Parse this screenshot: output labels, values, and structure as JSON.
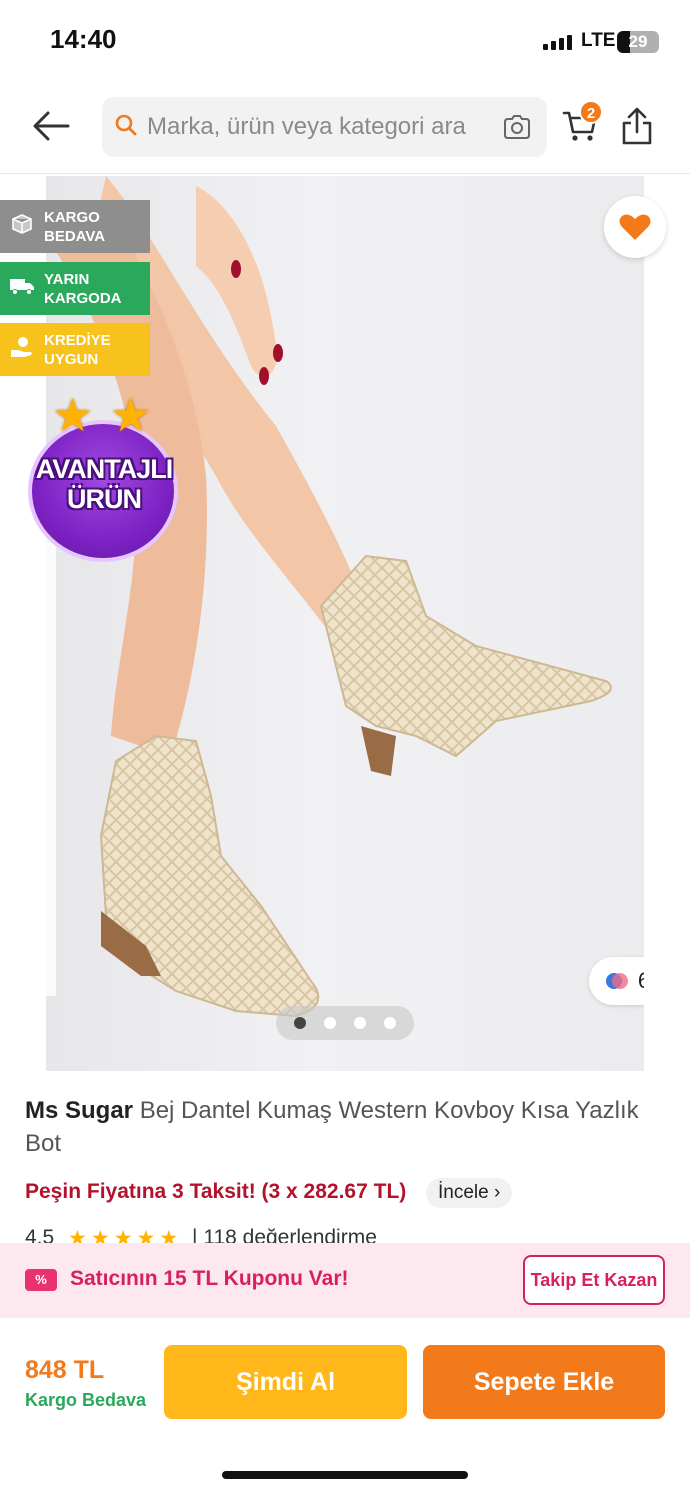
{
  "status_bar": {
    "time": "14:40",
    "network": "LTE",
    "battery": "29"
  },
  "header": {
    "search_placeholder": "Marka, ürün veya kategori ara",
    "cart_count": "2",
    "icons": [
      "back-arrow-icon",
      "search-icon",
      "camera-icon",
      "cart-icon",
      "share-icon"
    ]
  },
  "badges": {
    "kargo": "KARGO BEDAVA",
    "yarin": "YARIN KARGODA",
    "kredi": "KREDİYE UYGUN",
    "avantaj_line1": "AVANTAJLI",
    "avantaj_line2": "ÜRÜN"
  },
  "gallery": {
    "variant_count": "6",
    "page_count": 4,
    "active_page": 1
  },
  "product": {
    "brand": "Ms Sugar",
    "name": "Bej Dantel Kumaş Western Kovboy Kısa Yazlık Bot",
    "installment_text": "Peşin Fiyatına 3 Taksit! (3 x 282.67 TL)",
    "incele_label": "İncele",
    "rating_value": "4.5",
    "stars": "★★★★★",
    "review_text": "| 118 değerlendirme"
  },
  "coupon": {
    "icon_label": "%",
    "text": "Satıcının 15 TL Kuponu Var!",
    "button": "Takip Et Kazan"
  },
  "bottom": {
    "price": "848 TL",
    "shipping": "Kargo Bedava",
    "buy_now": "Şimdi Al",
    "add_to_cart": "Sepete Ekle"
  },
  "colors": {
    "brand_orange": "#f27a1a",
    "buy_yellow": "#ffb71a",
    "installment_red": "#b3122d",
    "coupon_pink": "#d81f63",
    "free_green": "#2aa85c"
  }
}
